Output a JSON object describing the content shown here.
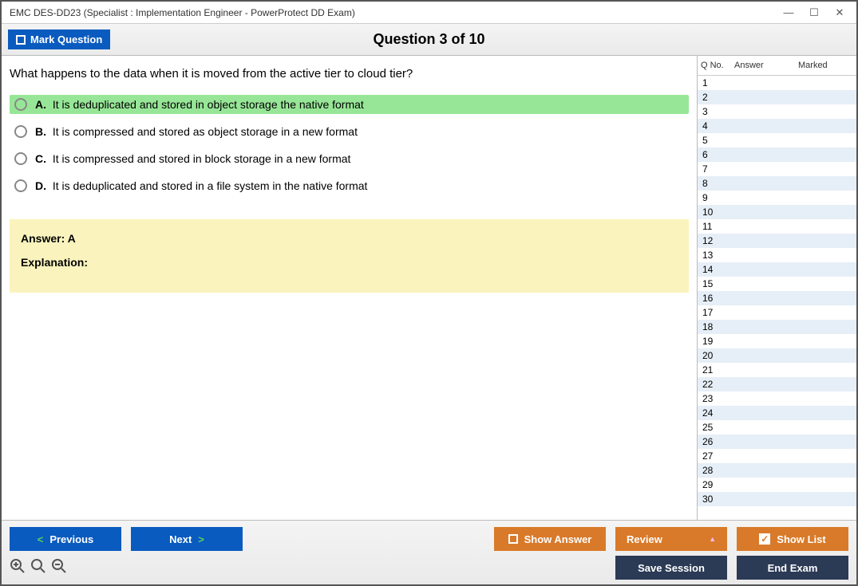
{
  "window": {
    "title": "EMC DES-DD23 (Specialist : Implementation Engineer - PowerProtect DD Exam)"
  },
  "topbar": {
    "mark_label": "Mark Question",
    "question_title": "Question 3 of 10"
  },
  "question": {
    "text": "What happens to the data when it is moved from the active tier to cloud tier?",
    "options": [
      {
        "letter": "A.",
        "text": "It is deduplicated and stored in object storage the native format",
        "selected": true
      },
      {
        "letter": "B.",
        "text": "It is compressed and stored as object storage in a new format",
        "selected": false
      },
      {
        "letter": "C.",
        "text": "It is compressed and stored in block storage in a new format",
        "selected": false
      },
      {
        "letter": "D.",
        "text": "It is deduplicated and stored in a file system in the native format",
        "selected": false
      }
    ],
    "answer_label": "Answer: A",
    "explanation_label": "Explanation:"
  },
  "sidebar": {
    "headers": {
      "qno": "Q No.",
      "answer": "Answer",
      "marked": "Marked"
    },
    "rows": [
      {
        "n": "1"
      },
      {
        "n": "2"
      },
      {
        "n": "3"
      },
      {
        "n": "4"
      },
      {
        "n": "5"
      },
      {
        "n": "6"
      },
      {
        "n": "7"
      },
      {
        "n": "8"
      },
      {
        "n": "9"
      },
      {
        "n": "10"
      },
      {
        "n": "11"
      },
      {
        "n": "12"
      },
      {
        "n": "13"
      },
      {
        "n": "14"
      },
      {
        "n": "15"
      },
      {
        "n": "16"
      },
      {
        "n": "17"
      },
      {
        "n": "18"
      },
      {
        "n": "19"
      },
      {
        "n": "20"
      },
      {
        "n": "21"
      },
      {
        "n": "22"
      },
      {
        "n": "23"
      },
      {
        "n": "24"
      },
      {
        "n": "25"
      },
      {
        "n": "26"
      },
      {
        "n": "27"
      },
      {
        "n": "28"
      },
      {
        "n": "29"
      },
      {
        "n": "30"
      }
    ]
  },
  "footer": {
    "previous": "Previous",
    "next": "Next",
    "show_answer": "Show Answer",
    "review": "Review",
    "show_list": "Show List",
    "save_session": "Save Session",
    "end_exam": "End Exam"
  }
}
